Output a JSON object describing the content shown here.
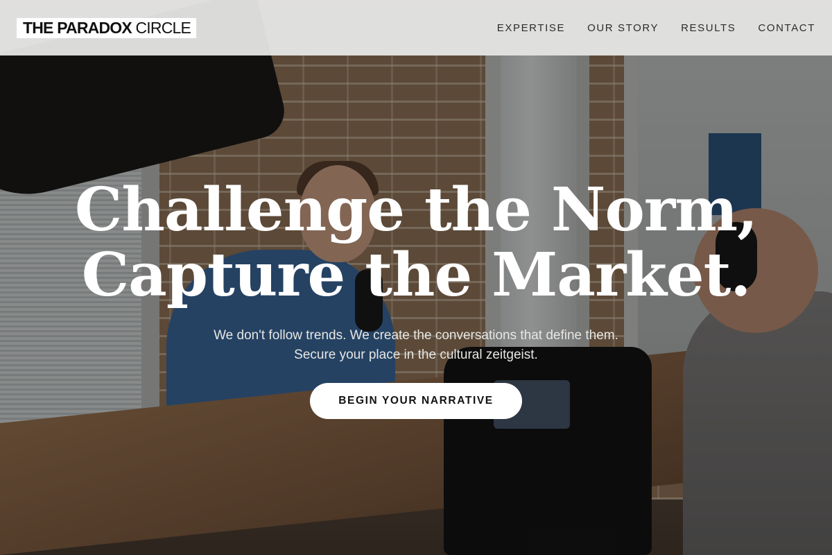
{
  "header": {
    "logo_strong": "THE PARADOX",
    "logo_light": "CIRCLE",
    "nav": [
      {
        "label": "EXPERTISE"
      },
      {
        "label": "OUR STORY"
      },
      {
        "label": "RESULTS"
      },
      {
        "label": "CONTACT"
      }
    ]
  },
  "hero": {
    "title_line1": "Challenge the Norm,",
    "title_line2": "Capture the Market.",
    "subtitle_line1": "We don't follow trends. We create the conversations that define them.",
    "subtitle_line2": "Secure your place in the cultural zeitgeist.",
    "cta_label": "BEGIN YOUR NARRATIVE"
  },
  "colors": {
    "header_bg": "#ecebea",
    "overlay": "rgba(0,0,0,0.40)",
    "cta_bg": "#ffffff",
    "text_light": "#ffffff"
  }
}
